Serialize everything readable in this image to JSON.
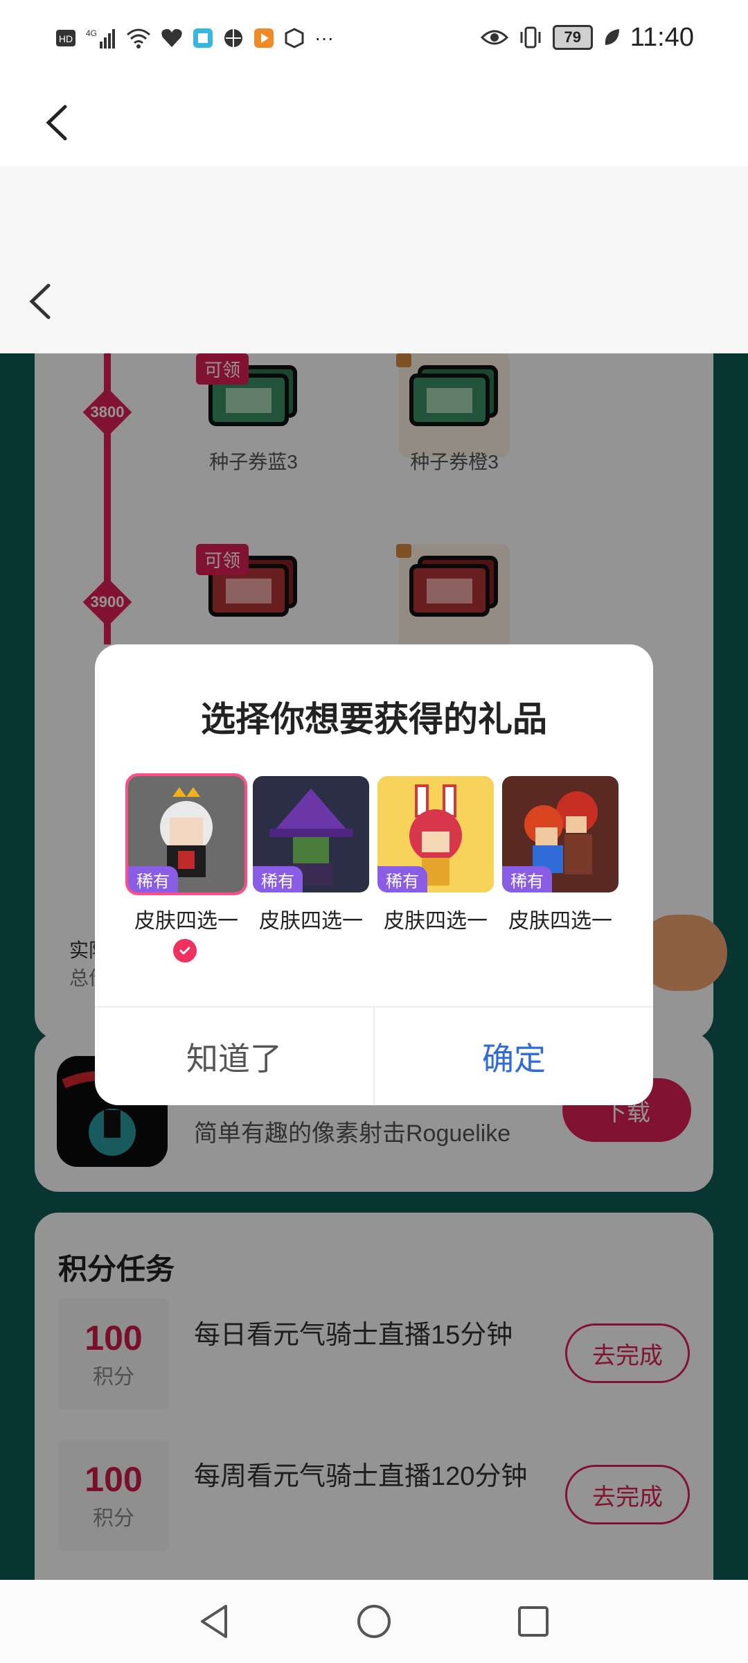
{
  "status_bar": {
    "left_icons": [
      "hd-icon",
      "signal-4g-icon",
      "wifi-icon",
      "health-icon",
      "app-icon-1",
      "app-icon-2",
      "app-icon-3",
      "app-icon-4",
      "more-icon"
    ],
    "battery": "79",
    "time": "11:40",
    "more": "···"
  },
  "rewards": {
    "tag_claimable": "可领",
    "nodes": [
      "3800",
      "3900"
    ],
    "row1": {
      "left_name": "种子券蓝3",
      "right_name": "种子券橙3"
    }
  },
  "download_card": {
    "description": "简单有趣的像素射击Roguelike",
    "button": "下载"
  },
  "tasks": {
    "title": "积分任务",
    "items": [
      {
        "points": "100",
        "unit": "积分",
        "text": "每日看元气骑士直播15分钟",
        "button": "去完成"
      },
      {
        "points": "100",
        "unit": "积分",
        "text": "每周看元气骑士直播120分钟",
        "button": "去完成"
      }
    ]
  },
  "background_partial": {
    "text1": "实际",
    "text2": "总价"
  },
  "dialog": {
    "title": "选择你想要获得的礼品",
    "gifts": [
      {
        "tag": "稀有",
        "label": "皮肤四选一",
        "selected": true
      },
      {
        "tag": "稀有",
        "label": "皮肤四选一",
        "selected": false
      },
      {
        "tag": "稀有",
        "label": "皮肤四选一",
        "selected": false
      },
      {
        "tag": "稀有",
        "label": "皮肤四选一",
        "selected": false
      }
    ],
    "cancel": "知道了",
    "confirm": "确定"
  },
  "colors": {
    "accent": "#e01f56",
    "confirm_blue": "#2f6cd8",
    "page_bg": "#0f5a57",
    "rare_tag": "#8a5de6"
  }
}
